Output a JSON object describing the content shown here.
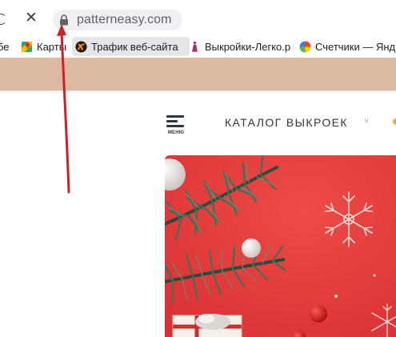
{
  "browser": {
    "url": "patterneasy.com",
    "stop_glyph": "✕"
  },
  "bookmarks": [
    {
      "label": "бе",
      "icon": "none"
    },
    {
      "label": "Карты",
      "icon": "maps-icon"
    },
    {
      "label": "Трафик веб-сайта",
      "icon": "traffic-icon"
    },
    {
      "label": "Выкройки-Легко.р",
      "icon": "dress-icon"
    },
    {
      "label": "Счетчики — Янд",
      "icon": "metrica-icon"
    }
  ],
  "site": {
    "menu_label": "МЕНЮ",
    "catalog_label": "КАТАЛОГ ВЫКРОЕК",
    "caret": "˅"
  },
  "colors": {
    "site_band": "#dcb9a2",
    "annotation_arrow": "#d11f26",
    "hero_background": "#e23b3b"
  }
}
